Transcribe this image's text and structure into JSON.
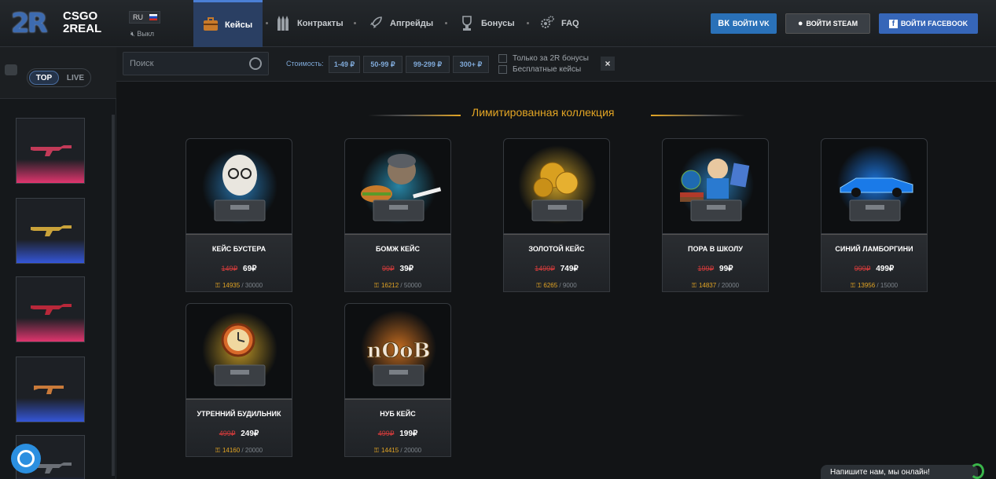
{
  "header": {
    "logo_mark": "2R",
    "logo_text_1": "CSGO",
    "logo_text_2": "2REAL",
    "lang": "RU",
    "sound": "Выкл",
    "nav": [
      {
        "label": "Кейсы",
        "icon": "case-icon",
        "active": true
      },
      {
        "label": "Контракты",
        "icon": "bullets-icon",
        "active": false
      },
      {
        "label": "Апгрейды",
        "icon": "rocket-icon",
        "active": false
      },
      {
        "label": "Бонусы",
        "icon": "trophy-icon",
        "active": false
      },
      {
        "label": "FAQ",
        "icon": "gears-icon",
        "active": false
      }
    ],
    "login": [
      {
        "label": "ВОЙТИ VK",
        "icon": "vk-icon",
        "color": "#2a71b8"
      },
      {
        "label": "ВОЙТИ STEAM",
        "icon": "steam-icon",
        "color": "#3a3f45"
      },
      {
        "label": "ВОЙТИ FACEBOOK",
        "icon": "facebook-icon",
        "color": "#3666b8"
      }
    ]
  },
  "sidebar": {
    "tabs": [
      {
        "label": "TOP",
        "active": true
      },
      {
        "label": "LIVE",
        "active": false
      }
    ],
    "drops": [
      {
        "rarity_color": "#e0356e"
      },
      {
        "rarity_color": "#3456d8"
      },
      {
        "rarity_color": "#e0356e"
      },
      {
        "rarity_color": "#3456d8"
      },
      {
        "rarity_color": "#3456d8"
      }
    ]
  },
  "filter": {
    "search_placeholder": "Поиск",
    "price_label": "Стоимость:",
    "prices": [
      "1-49 ₽",
      "50-99 ₽",
      "99-299 ₽",
      "300+ ₽"
    ],
    "checkbox_bonus": "Только за 2R бонусы",
    "checkbox_free": "Бесплатные кейсы",
    "close": "×"
  },
  "section": {
    "title": "Лимитированная коллекция"
  },
  "cases": [
    {
      "name": "КЕЙС БУСТЕРА",
      "old_price": "149₽",
      "price": "69₽",
      "opened": "14935",
      "total": "30000",
      "accent": "#2f8fd6"
    },
    {
      "name": "БОМЖ КЕЙС",
      "old_price": "99₽",
      "price": "39₽",
      "opened": "16212",
      "total": "50000",
      "accent": "#2ea0c8"
    },
    {
      "name": "ЗОЛОТОЙ КЕЙС",
      "old_price": "1499₽",
      "price": "749₽",
      "opened": "6265",
      "total": "9000",
      "accent": "#e8b52a"
    },
    {
      "name": "ПОРА В ШКОЛУ",
      "old_price": "199₽",
      "price": "99₽",
      "opened": "14837",
      "total": "20000",
      "accent": "#2f8fd6"
    },
    {
      "name": "СИНИЙ ЛАМБОРГИНИ",
      "old_price": "999₽",
      "price": "499₽",
      "opened": "13956",
      "total": "15000",
      "accent": "#1f86ff"
    },
    {
      "name": "УТРЕННИЙ БУДИЛЬНИК",
      "old_price": "499₽",
      "price": "249₽",
      "opened": "14160",
      "total": "20000",
      "accent": "#e8b52a"
    },
    {
      "name": "НУБ КЕЙС",
      "old_price": "499₽",
      "price": "199₽",
      "opened": "14415",
      "total": "20000",
      "accent": "#e07a22",
      "art_text": "nOoB"
    }
  ],
  "chat": {
    "label": "Напишите нам, мы онлайн!"
  }
}
